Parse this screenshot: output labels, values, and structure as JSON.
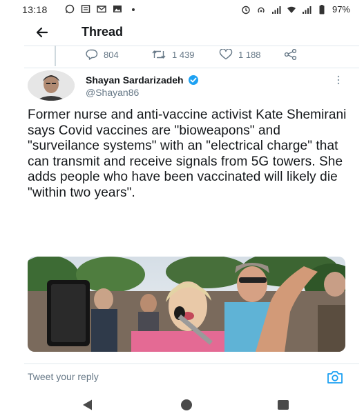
{
  "status_bar": {
    "time": "13:18",
    "battery": "97%",
    "left_icons": [
      "whatsapp-icon",
      "news-icon",
      "gmail-icon",
      "image-icon",
      "dot-icon"
    ],
    "right_icons": [
      "alarm-icon",
      "hotspot-icon",
      "signal-icon",
      "wifi-icon",
      "signal-icon",
      "battery-icon"
    ]
  },
  "header": {
    "title": "Thread",
    "back_icon": "arrow-left-icon"
  },
  "previous_tweet_actions": {
    "replies": "804",
    "retweets": "1 439",
    "likes": "1 188",
    "share_icon": "share-icon"
  },
  "tweet": {
    "author_name": "Shayan Sardarizadeh",
    "author_handle": "@Shayan86",
    "verified": true,
    "text": "Former nurse and anti-vaccine activist Kate Shemirani says Covid vaccines are \"bioweapons\" and \"surveilance systems\" with an \"electrical charge\" that can transmit and receive signals from 5G towers. She adds people who have been vaccinated will likely die \"within two years\"."
  },
  "reply_bar": {
    "placeholder": "Tweet your reply",
    "camera_icon": "camera-icon"
  },
  "nav_bar": {
    "icons": [
      "nav-back-icon",
      "nav-home-icon",
      "nav-recents-icon"
    ]
  },
  "colors": {
    "accent": "#1da1f2",
    "muted": "#657786",
    "text": "#14171a",
    "divider": "#e1e8ed"
  }
}
